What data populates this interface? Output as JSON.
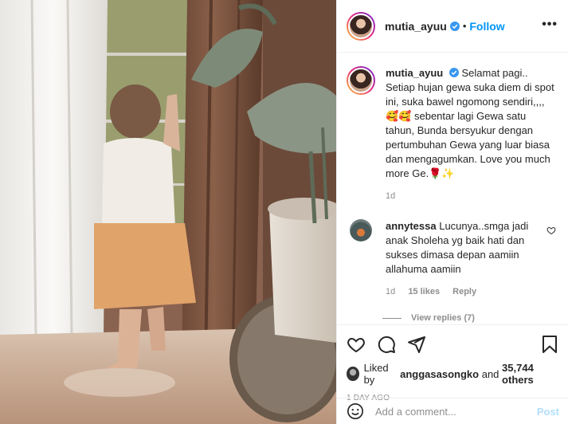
{
  "post": {
    "username": "mutia_ayuu",
    "follow_label": "Follow",
    "more_label": "•••",
    "separator": "•"
  },
  "caption": {
    "username": "mutia_ayuu",
    "text": "Selamat pagi.. Setiap hujan gewa suka diem di spot ini, suka bawel ngomong sendiri,,,, 🥰🥰 sebentar lagi Gewa satu tahun, Bunda bersyukur dengan pertumbuhan Gewa yang luar biasa dan mengagumkan. Love you much more Ge.🌹✨",
    "time": "1d"
  },
  "comment": {
    "username": "annytessa",
    "text": "Lucunya..smga jadi anak Sholeha yg baik hati dan sukses dimasa depan aamiin allahuma aamiin",
    "time": "1d",
    "likes": "15 likes",
    "reply": "Reply",
    "view_replies": "View replies (7)"
  },
  "likes": {
    "prefix": "Liked by",
    "user": "anggasasongko",
    "middle": "and",
    "others": "35,744 others"
  },
  "date": "1 DAY AGO",
  "add_comment": {
    "placeholder": "Add a comment...",
    "post_label": "Post"
  },
  "colors": {
    "accent": "#0095f6",
    "muted": "#8e8e8e",
    "post_disabled": "#b2dffc"
  },
  "icons": [
    "verified-badge-icon",
    "heart-icon",
    "comment-icon",
    "share-icon",
    "bookmark-icon",
    "emoji-icon",
    "more-icon"
  ]
}
